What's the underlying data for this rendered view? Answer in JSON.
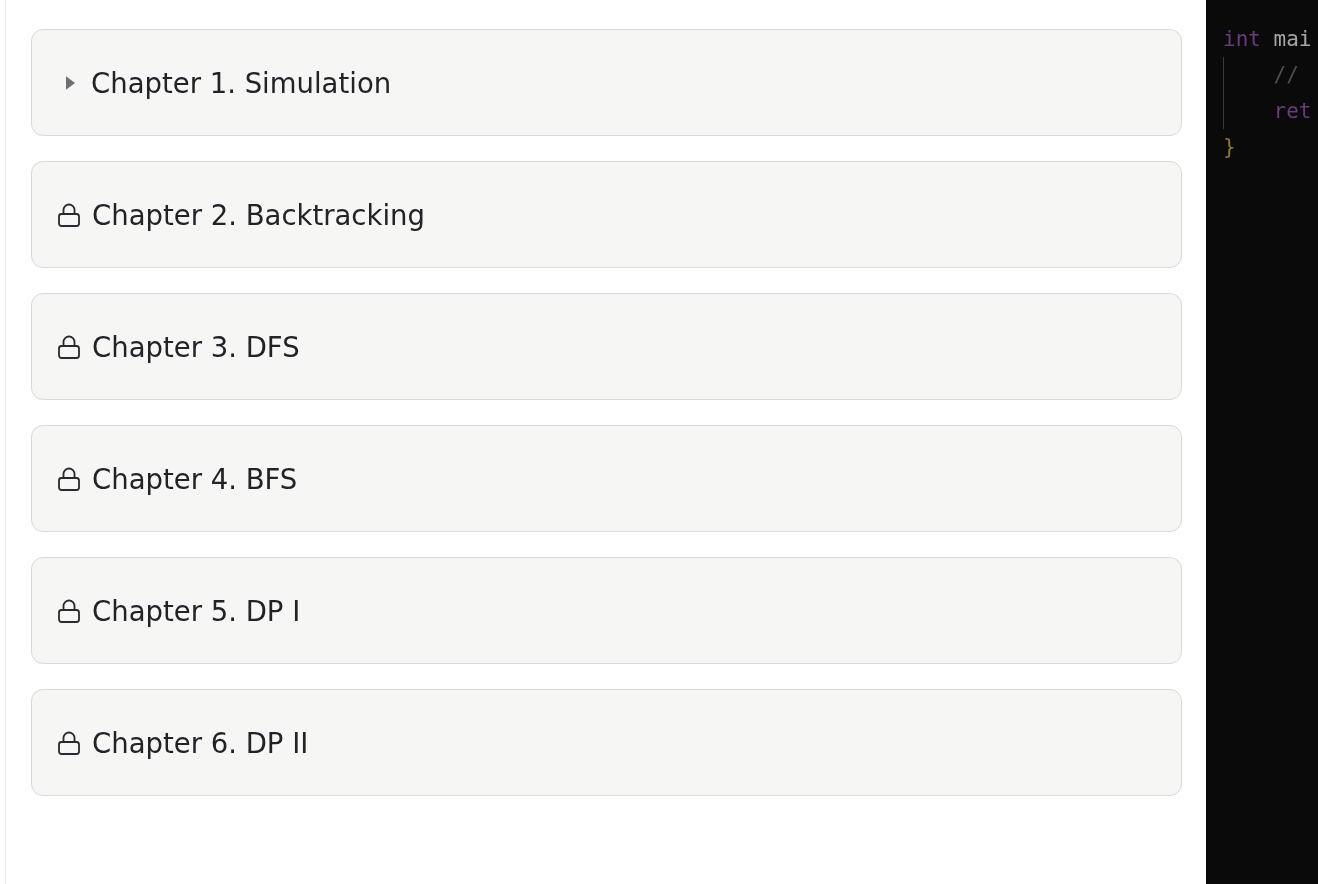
{
  "chapters": [
    {
      "title": "Chapter 1. Simulation",
      "locked": false,
      "expanded": false
    },
    {
      "title": "Chapter 2. Backtracking",
      "locked": true,
      "expanded": false
    },
    {
      "title": "Chapter 3. DFS",
      "locked": true,
      "expanded": false
    },
    {
      "title": "Chapter 4. BFS",
      "locked": true,
      "expanded": false
    },
    {
      "title": "Chapter 5. DP I",
      "locked": true,
      "expanded": false
    },
    {
      "title": "Chapter 6. DP II",
      "locked": true,
      "expanded": false
    }
  ],
  "code_editor": {
    "lines": [
      {
        "indented": false,
        "tokens": [
          {
            "text": "int",
            "kind": "keyword"
          },
          {
            "text": "mai",
            "kind": "identifier"
          }
        ]
      },
      {
        "indented": true,
        "tokens": [
          {
            "text": "//",
            "kind": "comment"
          }
        ]
      },
      {
        "indented": true,
        "tokens": [
          {
            "text": "ret",
            "kind": "keyword"
          }
        ]
      },
      {
        "indented": false,
        "tokens": [
          {
            "text": "}",
            "kind": "bracket"
          }
        ]
      }
    ]
  }
}
